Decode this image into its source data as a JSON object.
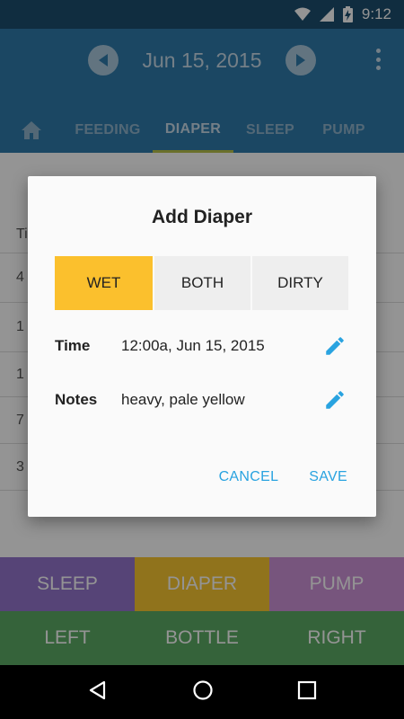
{
  "status_bar": {
    "time": "9:12",
    "icons": [
      "wifi-icon",
      "signal-icon",
      "battery-charging-icon"
    ]
  },
  "app_bar": {
    "date": "Jun 15, 2015",
    "tabs": [
      {
        "label": "FEEDING",
        "active": false
      },
      {
        "label": "DIAPER",
        "active": true
      },
      {
        "label": "SLEEP",
        "active": false
      },
      {
        "label": "PUMP",
        "active": false
      }
    ]
  },
  "background_list": {
    "header": "Ti",
    "rows": [
      "4",
      "1",
      "1",
      "7",
      "3"
    ]
  },
  "bottom_grid": {
    "top_row": [
      {
        "label": "SLEEP",
        "color": "#9575cd"
      },
      {
        "label": "DIAPER",
        "color": "#f9c631"
      },
      {
        "label": "PUMP",
        "color": "#ce93d8"
      }
    ],
    "bottom_row": [
      {
        "label": "LEFT",
        "color": "#5cab64"
      },
      {
        "label": "BOTTLE",
        "color": "#5cab64"
      },
      {
        "label": "RIGHT",
        "color": "#5cab64"
      }
    ]
  },
  "dialog": {
    "title": "Add Diaper",
    "options": [
      "WET",
      "BOTH",
      "DIRTY"
    ],
    "selected_option": "WET",
    "time_label": "Time",
    "time_value": "12:00a,  Jun 15, 2015",
    "notes_label": "Notes",
    "notes_value": "heavy, pale yellow",
    "cancel_label": "CANCEL",
    "save_label": "SAVE"
  },
  "colors": {
    "app_bar": "#2f7bab",
    "status_bar": "#1d4f6e",
    "accent": "#29a3e0",
    "selected": "#fbc02d"
  }
}
